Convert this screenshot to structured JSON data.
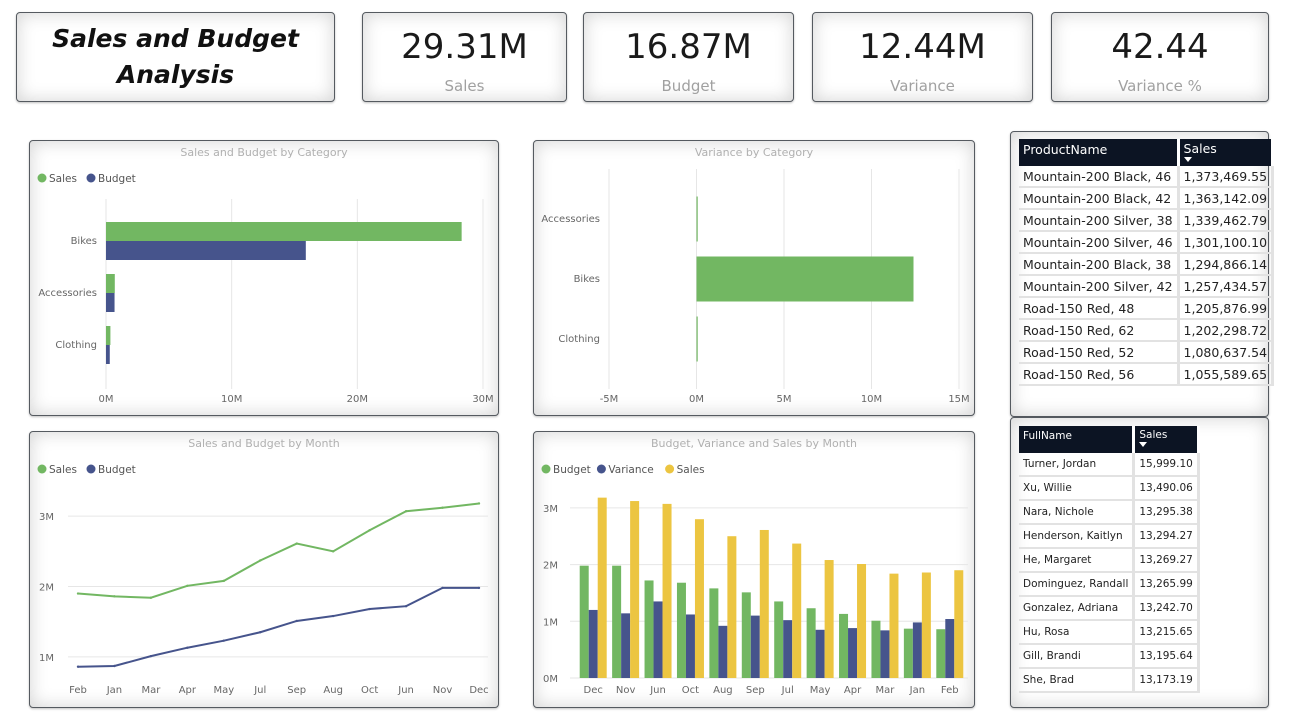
{
  "page": {
    "title": "Sales and Budget Analysis"
  },
  "kpis": [
    {
      "value": "29.31M",
      "label": "Sales"
    },
    {
      "value": "16.87M",
      "label": "Budget"
    },
    {
      "value": "12.44M",
      "label": "Variance"
    },
    {
      "value": "42.44",
      "label": "Variance %"
    }
  ],
  "colors": {
    "sales_green": "#72b762",
    "budget_navy": "#46548c",
    "sales_yellow": "#ecc541",
    "header_dark": "#0c1423"
  },
  "chart_data": [
    {
      "id": "sales-budget-by-category",
      "type": "bar",
      "orientation": "horizontal",
      "title": "Sales and Budget by Category",
      "categories": [
        "Bikes",
        "Accessories",
        "Clothing"
      ],
      "series": [
        {
          "name": "Sales",
          "values": [
            28.3,
            0.7,
            0.35
          ]
        },
        {
          "name": "Budget",
          "values": [
            15.9,
            0.68,
            0.3
          ]
        }
      ],
      "xlim": [
        0,
        30
      ],
      "ticks": [
        "0M",
        "10M",
        "20M",
        "30M"
      ],
      "tick_values": [
        0,
        10,
        20,
        30
      ],
      "legend": "top-left",
      "grid": true
    },
    {
      "id": "variance-by-category",
      "type": "bar",
      "orientation": "horizontal",
      "title": "Variance by Category",
      "categories": [
        "Accessories",
        "Bikes",
        "Clothing"
      ],
      "series": [
        {
          "name": "Variance",
          "values": [
            0.05,
            12.4,
            0.05
          ]
        }
      ],
      "xlim": [
        -5,
        15
      ],
      "ticks": [
        "-5M",
        "0M",
        "5M",
        "10M",
        "15M"
      ],
      "tick_values": [
        -5,
        0,
        5,
        10,
        15
      ],
      "grid": true
    },
    {
      "id": "sales-budget-by-month",
      "type": "line",
      "title": "Sales and Budget by Month",
      "categories": [
        "Feb",
        "Jan",
        "Mar",
        "Apr",
        "May",
        "Jul",
        "Sep",
        "Aug",
        "Oct",
        "Jun",
        "Nov",
        "Dec"
      ],
      "series": [
        {
          "name": "Sales",
          "values": [
            1.9,
            1.86,
            1.84,
            2.01,
            2.08,
            2.37,
            2.61,
            2.5,
            2.8,
            3.07,
            3.12,
            3.18
          ]
        },
        {
          "name": "Budget",
          "values": [
            0.86,
            0.87,
            1.01,
            1.13,
            1.23,
            1.35,
            1.51,
            1.58,
            1.68,
            1.72,
            1.98,
            1.98
          ]
        }
      ],
      "ylim": [
        0.6,
        3.4
      ],
      "ticks": [
        "1M",
        "2M",
        "3M"
      ],
      "tick_values": [
        1,
        2,
        3
      ],
      "legend": "top-left",
      "grid": true
    },
    {
      "id": "budget-variance-sales-by-month",
      "type": "bar",
      "title": "Budget, Variance and Sales by Month",
      "categories": [
        "Dec",
        "Nov",
        "Jun",
        "Oct",
        "Aug",
        "Sep",
        "Jul",
        "May",
        "Apr",
        "Mar",
        "Jan",
        "Feb"
      ],
      "series": [
        {
          "name": "Budget",
          "values": [
            1.98,
            1.98,
            1.72,
            1.68,
            1.58,
            1.51,
            1.35,
            1.23,
            1.13,
            1.01,
            0.87,
            0.86
          ]
        },
        {
          "name": "Variance",
          "values": [
            1.2,
            1.14,
            1.35,
            1.12,
            0.92,
            1.1,
            1.02,
            0.85,
            0.88,
            0.84,
            0.98,
            1.04
          ]
        },
        {
          "name": "Sales",
          "values": [
            3.18,
            3.12,
            3.07,
            2.8,
            2.5,
            2.61,
            2.37,
            2.08,
            2.01,
            1.84,
            1.86,
            1.9
          ]
        }
      ],
      "ylim": [
        0,
        3.35
      ],
      "ticks": [
        "0M",
        "1M",
        "2M",
        "3M"
      ],
      "tick_values": [
        0,
        1,
        2,
        3
      ],
      "legend": "top-left",
      "grid": true
    }
  ],
  "products_table": {
    "headers": [
      "ProductName",
      "Sales"
    ],
    "rows": [
      [
        "Mountain-200 Black, 46",
        "1,373,469.55"
      ],
      [
        "Mountain-200 Black, 42",
        "1,363,142.09"
      ],
      [
        "Mountain-200 Silver, 38",
        "1,339,462.79"
      ],
      [
        "Mountain-200 Silver, 46",
        "1,301,100.10"
      ],
      [
        "Mountain-200 Black, 38",
        "1,294,866.14"
      ],
      [
        "Mountain-200 Silver, 42",
        "1,257,434.57"
      ],
      [
        "Road-150 Red, 48",
        "1,205,876.99"
      ],
      [
        "Road-150 Red, 62",
        "1,202,298.72"
      ],
      [
        "Road-150 Red, 52",
        "1,080,637.54"
      ],
      [
        "Road-150 Red, 56",
        "1,055,589.65"
      ]
    ]
  },
  "customers_table": {
    "headers": [
      "FullName",
      "Sales"
    ],
    "rows": [
      [
        "Turner, Jordan",
        "15,999.10"
      ],
      [
        "Xu, Willie",
        "13,490.06"
      ],
      [
        "Nara, Nichole",
        "13,295.38"
      ],
      [
        "Henderson, Kaitlyn",
        "13,294.27"
      ],
      [
        "He, Margaret",
        "13,269.27"
      ],
      [
        "Dominguez, Randall",
        "13,265.99"
      ],
      [
        "Gonzalez, Adriana",
        "13,242.70"
      ],
      [
        "Hu, Rosa",
        "13,215.65"
      ],
      [
        "Gill, Brandi",
        "13,195.64"
      ],
      [
        "She, Brad",
        "13,173.19"
      ]
    ]
  }
}
